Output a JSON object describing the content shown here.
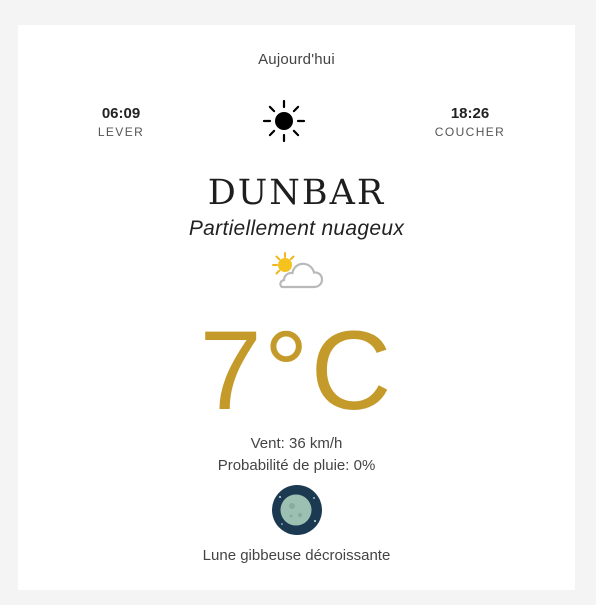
{
  "today_label": "Aujourd'hui",
  "sunrise": {
    "time": "06:09",
    "label": "LEVER"
  },
  "sunset": {
    "time": "18:26",
    "label": "COUCHER"
  },
  "city": "DUNBAR",
  "condition": "Partiellement nuageux",
  "temperature": "7°C",
  "wind": "Vent: 36 km/h",
  "rain_probability": "Probabilité de pluie: 0%",
  "moon_phase": "Lune gibbeuse décroissante",
  "icons": {
    "sun": "sun-icon",
    "condition": "partly-cloudy-icon",
    "moon": "moon-icon"
  },
  "colors": {
    "temperature": "#c49a2a",
    "moon_background": "#1b3a52",
    "moon_disc": "#9cc1b2"
  }
}
